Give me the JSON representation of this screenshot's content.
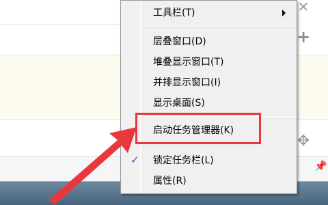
{
  "menu": {
    "toolbars_label": "工具栏(T)",
    "cascade_label": "层叠窗口(D)",
    "stack_label": "堆叠显示窗口(T)",
    "side_by_side_label": "并排显示窗口(I)",
    "show_desktop_label": "显示桌面(S)",
    "task_manager_label": "启动任务管理器(K)",
    "lock_taskbar_label": "锁定任务栏(L)",
    "properties_label": "属性(R)",
    "lock_checked_mark": "✓"
  },
  "icons": {
    "close": "close-icon",
    "plus": "plus-icon",
    "move": "move-icon",
    "pin": "pin-icon",
    "submenu_arrow": "chevron-right-icon",
    "check": "check-icon"
  },
  "colors": {
    "highlight": "#e8383d",
    "arrow": "#e8383d",
    "check": "#2a5ea8",
    "menu_bg": "#f0f0f0",
    "taskbar": "#46647c"
  }
}
